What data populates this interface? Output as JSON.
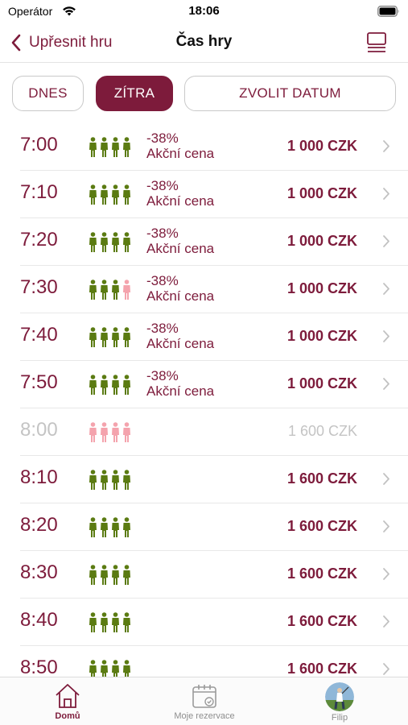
{
  "status_bar": {
    "carrier": "Operátor",
    "time": "18:06"
  },
  "nav": {
    "back_label": "Upřesnit hru",
    "title": "Čas hry"
  },
  "date_tabs": [
    {
      "label": "DNES",
      "selected": false
    },
    {
      "label": "ZÍTRA",
      "selected": true
    },
    {
      "label": "ZVOLIT DATUM",
      "selected": false
    }
  ],
  "colors": {
    "accent": "#7d1b3b",
    "available_player": "#5b7b12",
    "taken_player": "#f4a3ad",
    "disabled_text": "#c4c4c4"
  },
  "tee_times": [
    {
      "time": "7:00",
      "players": [
        "free",
        "free",
        "free",
        "free"
      ],
      "discount": "-38%",
      "discount_label": "Akční cena",
      "price": "1 000 CZK",
      "available": true
    },
    {
      "time": "7:10",
      "players": [
        "free",
        "free",
        "free",
        "free"
      ],
      "discount": "-38%",
      "discount_label": "Akční cena",
      "price": "1 000 CZK",
      "available": true
    },
    {
      "time": "7:20",
      "players": [
        "free",
        "free",
        "free",
        "free"
      ],
      "discount": "-38%",
      "discount_label": "Akční cena",
      "price": "1 000 CZK",
      "available": true
    },
    {
      "time": "7:30",
      "players": [
        "free",
        "free",
        "free",
        "taken"
      ],
      "discount": "-38%",
      "discount_label": "Akční cena",
      "price": "1 000 CZK",
      "available": true
    },
    {
      "time": "7:40",
      "players": [
        "free",
        "free",
        "free",
        "free"
      ],
      "discount": "-38%",
      "discount_label": "Akční cena",
      "price": "1 000 CZK",
      "available": true
    },
    {
      "time": "7:50",
      "players": [
        "free",
        "free",
        "free",
        "free"
      ],
      "discount": "-38%",
      "discount_label": "Akční cena",
      "price": "1 000 CZK",
      "available": true
    },
    {
      "time": "8:00",
      "players": [
        "taken",
        "taken",
        "taken",
        "taken"
      ],
      "discount": "",
      "discount_label": "",
      "price": "1 600 CZK",
      "available": false
    },
    {
      "time": "8:10",
      "players": [
        "free",
        "free",
        "free",
        "free"
      ],
      "discount": "",
      "discount_label": "",
      "price": "1 600 CZK",
      "available": true
    },
    {
      "time": "8:20",
      "players": [
        "free",
        "free",
        "free",
        "free"
      ],
      "discount": "",
      "discount_label": "",
      "price": "1 600 CZK",
      "available": true
    },
    {
      "time": "8:30",
      "players": [
        "free",
        "free",
        "free",
        "free"
      ],
      "discount": "",
      "discount_label": "",
      "price": "1 600 CZK",
      "available": true
    },
    {
      "time": "8:40",
      "players": [
        "free",
        "free",
        "free",
        "free"
      ],
      "discount": "",
      "discount_label": "",
      "price": "1 600 CZK",
      "available": true
    },
    {
      "time": "8:50",
      "players": [
        "free",
        "free",
        "free",
        "free"
      ],
      "discount": "",
      "discount_label": "",
      "price": "1 600 CZK",
      "available": true
    }
  ],
  "tab_bar": [
    {
      "label": "Domů",
      "icon": "home-icon",
      "active": true
    },
    {
      "label": "Moje rezervace",
      "icon": "calendar-check-icon",
      "active": false
    },
    {
      "label": "Filip",
      "icon": "avatar",
      "active": false
    }
  ]
}
